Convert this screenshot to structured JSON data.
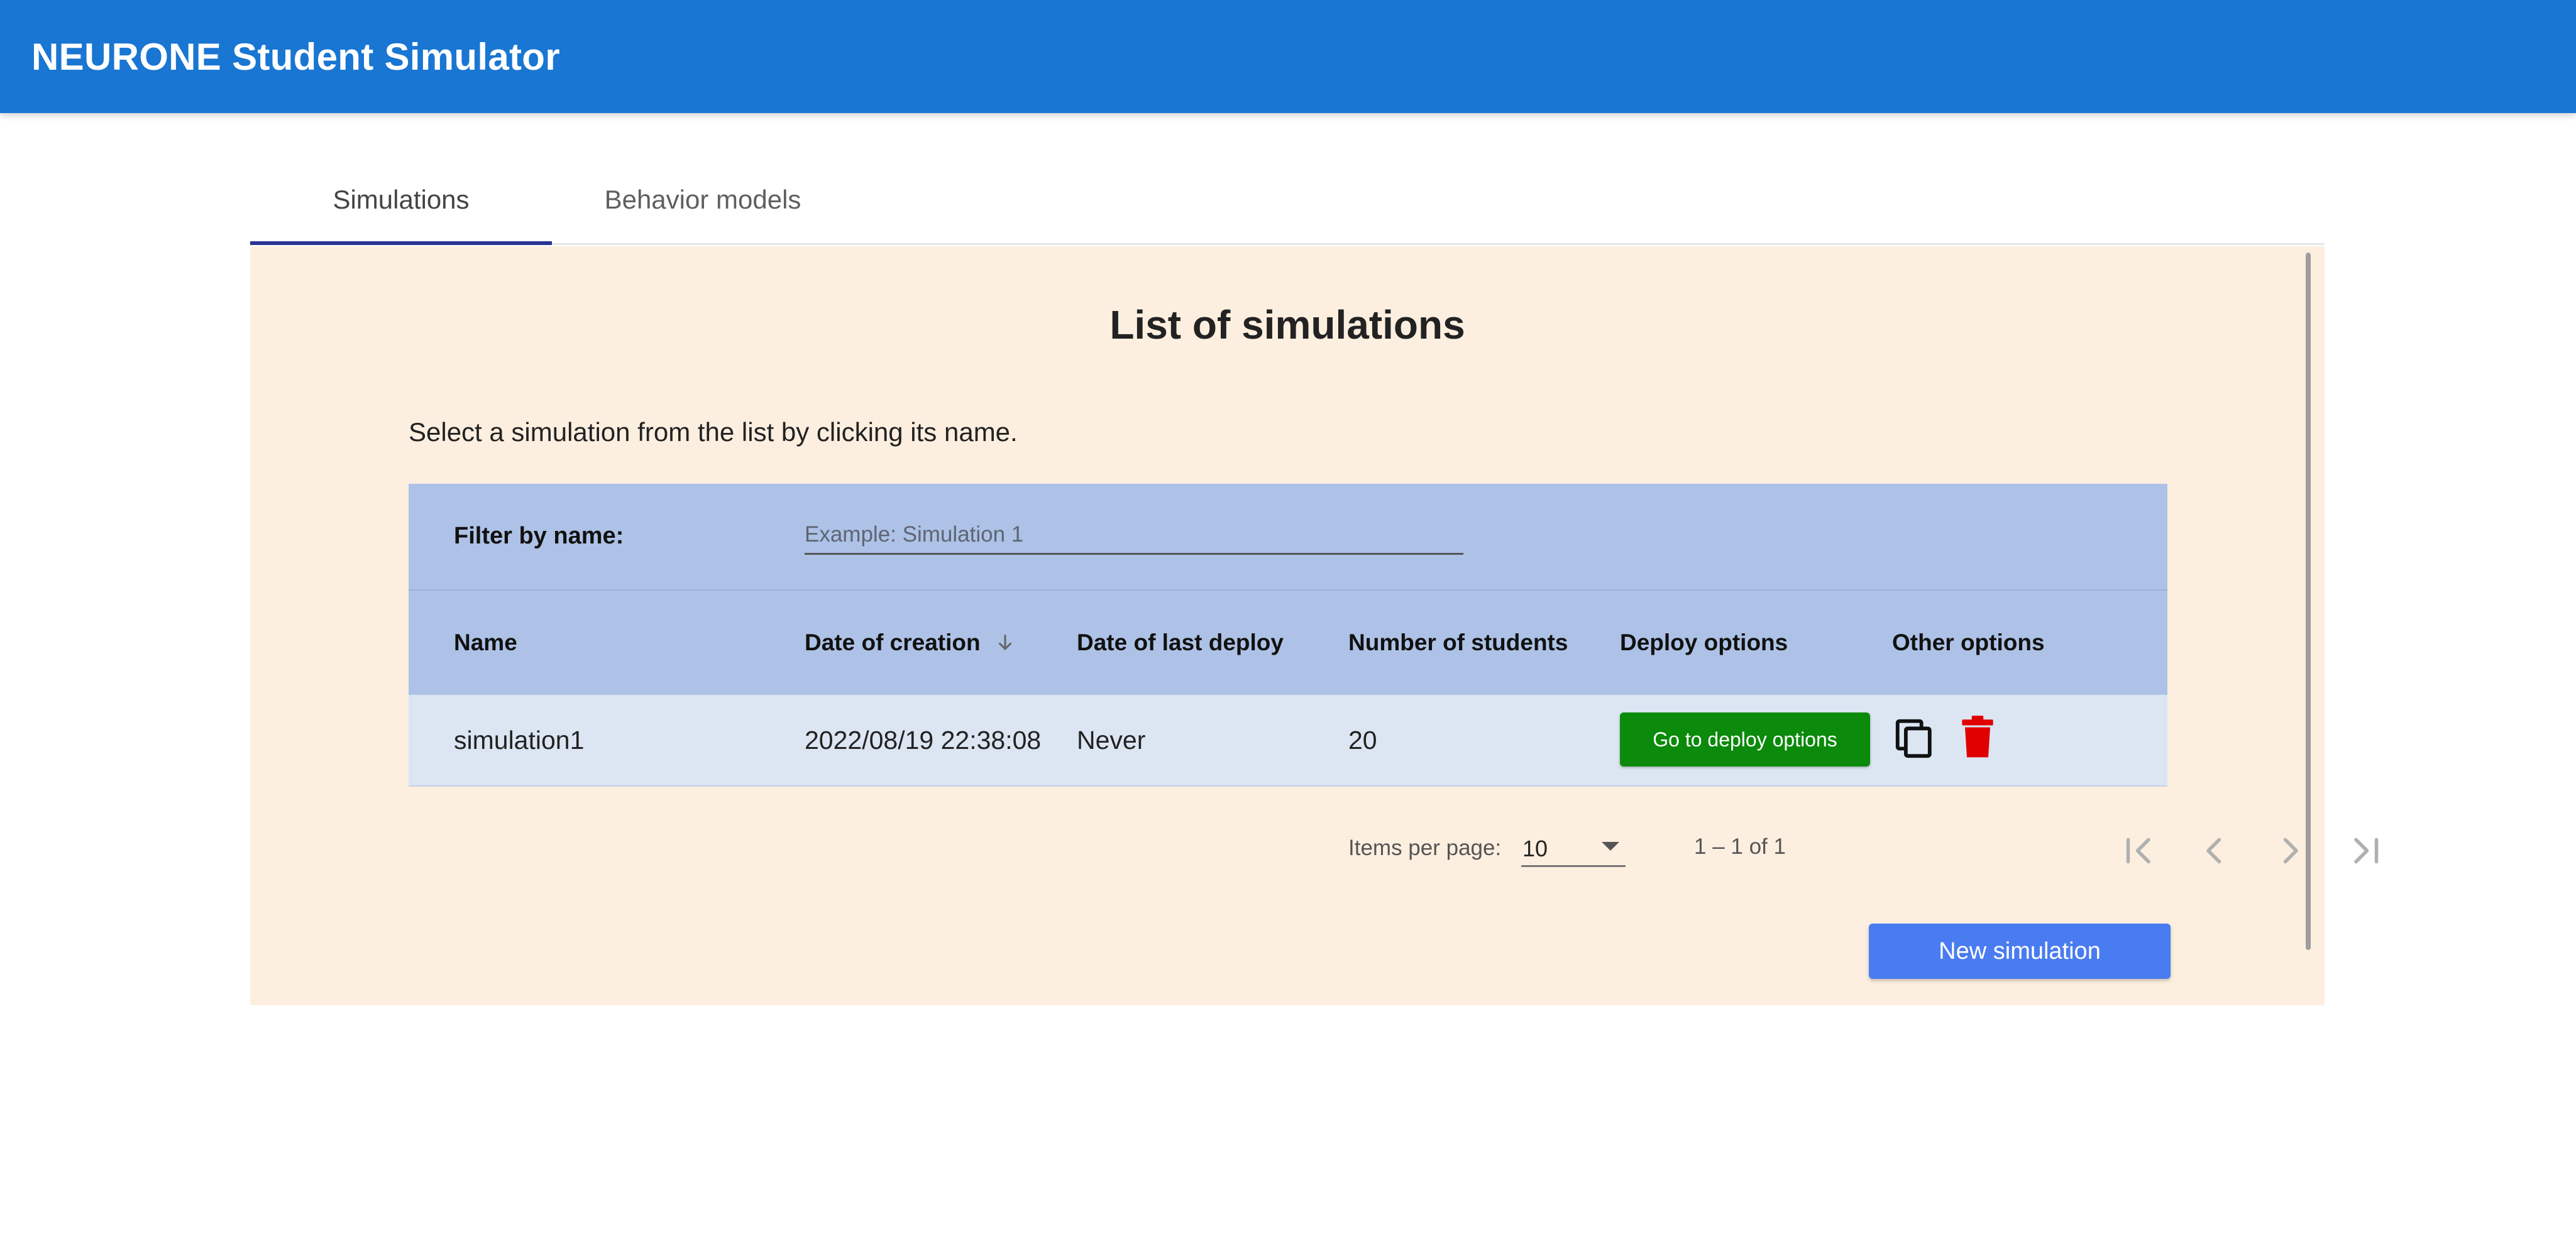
{
  "app": {
    "title": "NEURONE Student Simulator"
  },
  "tabs": [
    {
      "label": "Simulations",
      "active": true
    },
    {
      "label": "Behavior models",
      "active": false
    }
  ],
  "panel": {
    "heading": "List of simulations",
    "instructions": "Select a simulation from the list by clicking its name."
  },
  "filter": {
    "label": "Filter by name:",
    "placeholder": "Example: Simulation 1",
    "value": ""
  },
  "table": {
    "columns": [
      "Name",
      "Date of creation",
      "Date of last deploy",
      "Number of students",
      "Deploy options",
      "Other options"
    ],
    "sort": {
      "column": "Date of creation",
      "direction": "descending",
      "icon": "arrow-down-icon"
    },
    "rows": [
      {
        "name": "simulation1",
        "date_of_creation": "2022/08/19 22:38:08",
        "date_of_last_deploy": "Never",
        "number_of_students": "20",
        "deploy_button": "Go to deploy options",
        "other_options": [
          "copy-icon",
          "delete-icon"
        ]
      }
    ]
  },
  "paginator": {
    "items_per_page_label": "Items per page:",
    "items_per_page_value": "10",
    "range_label": "1 – 1 of 1",
    "buttons": [
      "first-page-icon",
      "previous-page-icon",
      "next-page-icon",
      "last-page-icon"
    ]
  },
  "actions": {
    "new_simulation": "New simulation"
  },
  "colors": {
    "app_bar": "#1976d2",
    "panel_background": "#fdefe0",
    "table_header": "#adc2e6",
    "table_row": "#dce6f3",
    "deploy_button": "#0b8a0b",
    "delete_icon": "#e00000",
    "new_simulation_button": "#4a7cf1",
    "tab_indicator": "#283593"
  }
}
